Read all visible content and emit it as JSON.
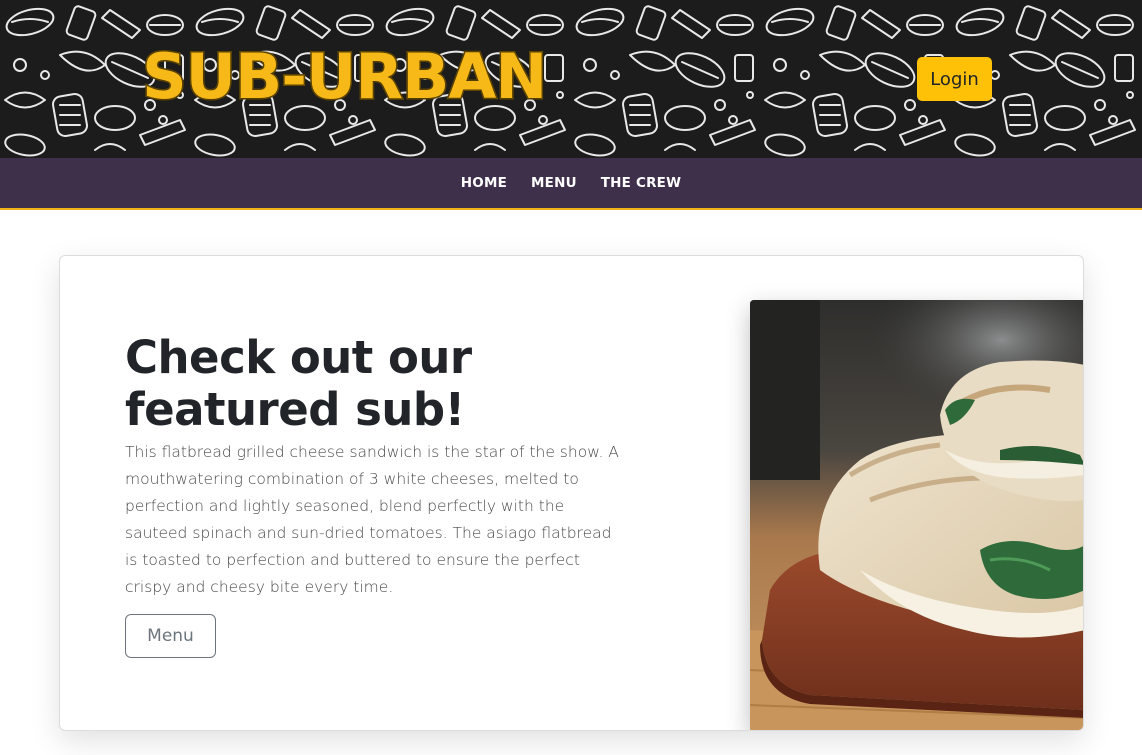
{
  "header": {
    "logo_text": "SUB-URBAN",
    "login_label": "Login"
  },
  "nav": {
    "items": [
      {
        "label": "HOME"
      },
      {
        "label": "MENU"
      },
      {
        "label": "THE CREW"
      }
    ]
  },
  "featured": {
    "title": "Check out our featured sub!",
    "description": "This flatbread grilled cheese sandwich is the star of the show. A mouthwatering combination of 3 white cheeses, melted to perfection and lightly seasoned, blend perfectly with the sauteed spinach and sun-dried tomatoes. The asiago flatbread is toasted to perfection and buttered to ensure the perfect crispy and cheesy bite every time.",
    "button_label": "Menu"
  },
  "colors": {
    "accent": "#ffc107",
    "nav_background": "#3e2f4b",
    "header_background": "#1c1c1c",
    "logo": "#f7b917"
  },
  "icons": {
    "header_pattern": "food-doodle-pattern",
    "photo": "grilled-cheese-sandwich-photo"
  }
}
